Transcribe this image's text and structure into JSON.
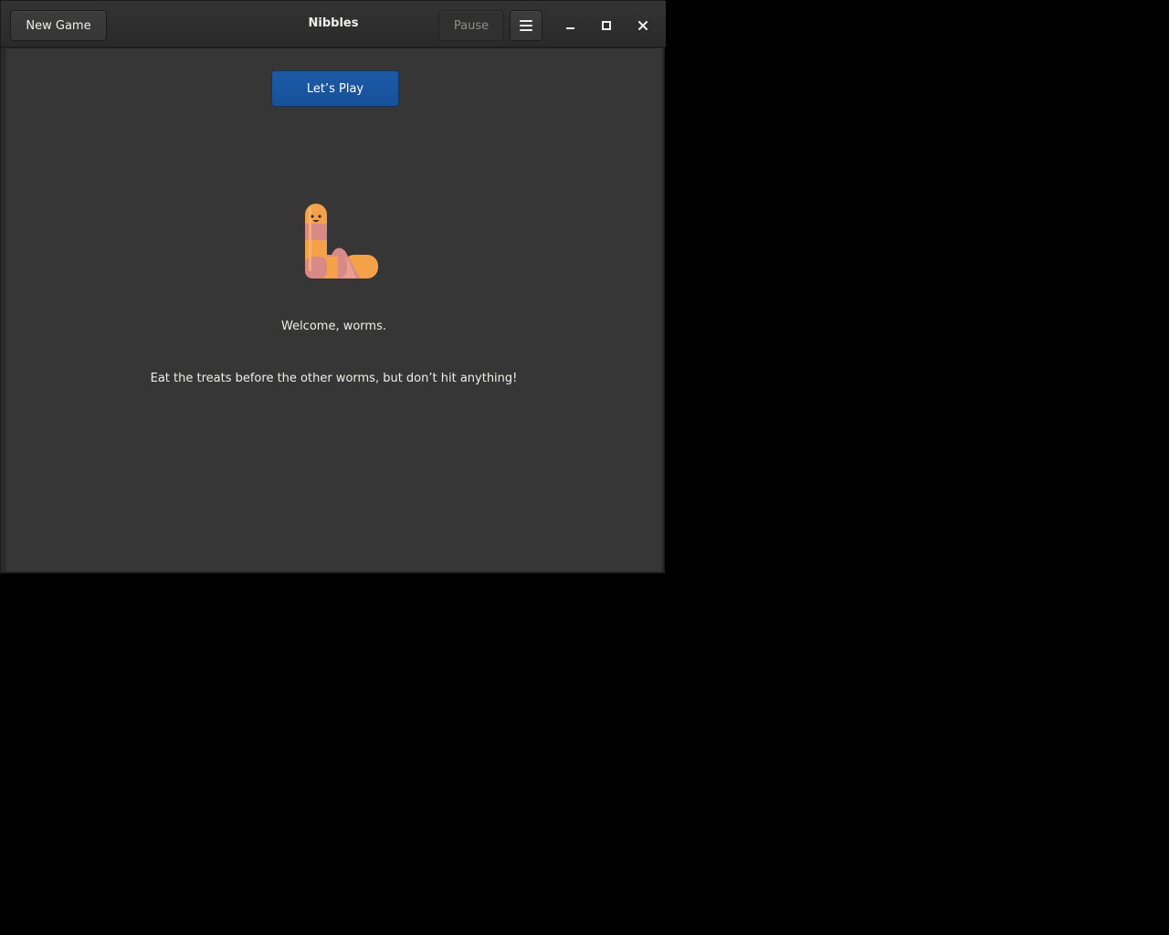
{
  "window": {
    "title": "Nibbles"
  },
  "headerbar": {
    "new_game_label": "New Game",
    "pause_label": "Pause",
    "menu_icon": "hamburger-menu-icon",
    "minimize_icon": "minimize-icon",
    "maximize_icon": "maximize-icon",
    "close_icon": "close-icon"
  },
  "main": {
    "play_button_label": "Let’s Play",
    "mascot_icon": "worm-icon",
    "welcome_text": "Welcome, worms.",
    "instructions_text": "Eat the treats before the other worms, but don’t hit anything!"
  },
  "colors": {
    "accent": "#1c5aa6",
    "window_bg": "#363636",
    "headerbar_bg": "#2f2f2f",
    "text": "#eeeeec",
    "worm_orange": "#f5a14a",
    "worm_pink": "#d98a86"
  }
}
